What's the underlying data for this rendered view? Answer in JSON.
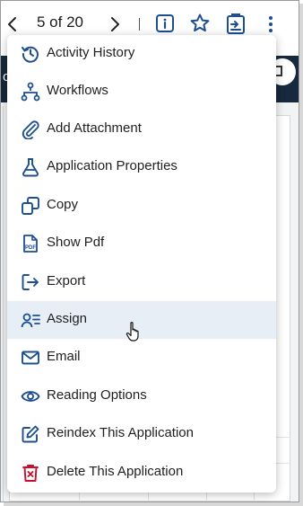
{
  "topbar": {
    "page_counter": "5 of 20",
    "icons": [
      "chevron-left-icon",
      "chevron-right-icon",
      "info-icon",
      "star-icon",
      "assign-clipboard-icon",
      "more-vertical-icon"
    ]
  },
  "background": {
    "band_text": "o"
  },
  "menu": {
    "items": [
      {
        "label": "Activity History",
        "icon": "history-icon"
      },
      {
        "label": "Workflows",
        "icon": "workflow-icon"
      },
      {
        "label": "Add Attachment",
        "icon": "paperclip-icon"
      },
      {
        "label": "Application Properties",
        "icon": "flask-icon"
      },
      {
        "label": "Copy",
        "icon": "copy-icon"
      },
      {
        "label": "Show Pdf",
        "icon": "pdf-icon"
      },
      {
        "label": "Export",
        "icon": "export-icon"
      },
      {
        "label": "Assign",
        "icon": "assign-user-icon"
      },
      {
        "label": "Email",
        "icon": "email-icon"
      },
      {
        "label": "Reading Options",
        "icon": "eye-icon"
      },
      {
        "label": "Reindex This Application",
        "icon": "edit-icon"
      },
      {
        "label": "Delete This Application",
        "icon": "trash-icon"
      }
    ],
    "hovered": "Assign"
  },
  "colors": {
    "icon_blue": "#1d4f91",
    "delete_red": "#c8102e",
    "dark_band": "#17293e",
    "hover_bg": "#e8eef6"
  }
}
